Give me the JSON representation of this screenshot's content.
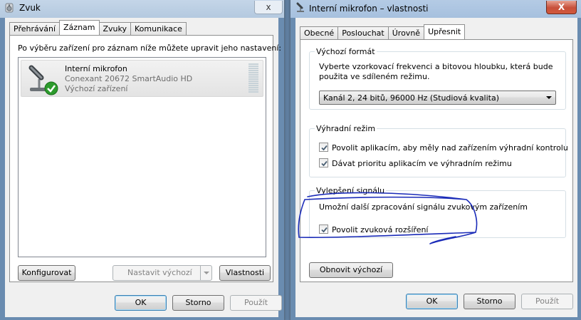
{
  "left_window": {
    "title": "Zvuk",
    "close_label": "x",
    "tabs": [
      {
        "label": "Přehrávání"
      },
      {
        "label": "Záznam"
      },
      {
        "label": "Zvuky"
      },
      {
        "label": "Komunikace"
      }
    ],
    "active_tab": "Záznam",
    "instruction": "Po výběru zařízení pro záznam níže můžete upravit jeho nastavení:",
    "device": {
      "name": "Interní mikrofon",
      "driver": "Conexant 20672 SmartAudio HD",
      "status": "Výchozí zařízení"
    },
    "buttons": {
      "configure": "Konfigurovat",
      "set_default": "Nastavit výchozí",
      "properties": "Vlastnosti",
      "ok": "OK",
      "cancel": "Storno",
      "apply": "Použít"
    }
  },
  "right_window": {
    "title": "Interní mikrofon – vlastnosti",
    "close_label": "X",
    "tabs": [
      {
        "label": "Obecné"
      },
      {
        "label": "Poslouchat"
      },
      {
        "label": "Úrovně"
      },
      {
        "label": "Upřesnit"
      }
    ],
    "active_tab": "Upřesnit",
    "default_format": {
      "title": "Výchozí formát",
      "description_line1": "Vyberte vzorkovací frekvenci a bitovou hloubku, která bude",
      "description_line2": "použita ve sdíleném režimu.",
      "selected": "Kanál 2, 24 bitů, 96000 Hz (Studiová kvalita)"
    },
    "exclusive_mode": {
      "title": "Výhradní režim",
      "option1": "Povolit aplikacím, aby měly nad zařízením výhradní kontrolu",
      "option1_checked": true,
      "option2": "Dávat prioritu aplikacím ve výhradním režimu",
      "option2_checked": true
    },
    "signal_enhancement": {
      "title": "Vylepšení signálu",
      "description": "Umožní další zpracování signálu zvukovým zařízením",
      "option": "Povolit zvuková rozšíření",
      "option_checked": true
    },
    "buttons": {
      "restore_defaults": "Obnovit výchozí",
      "ok": "OK",
      "cancel": "Storno",
      "apply": "Použít"
    }
  },
  "colors": {
    "annotation": "#1a2bb8",
    "frame": "#b9cde2",
    "close_button": "#c7503b",
    "check_green": "#2c9b2c"
  },
  "icons": {
    "speaker_icon": "speaker-icon",
    "microphone_icon": "microphone-icon",
    "default_check_icon": "green-check-icon"
  }
}
